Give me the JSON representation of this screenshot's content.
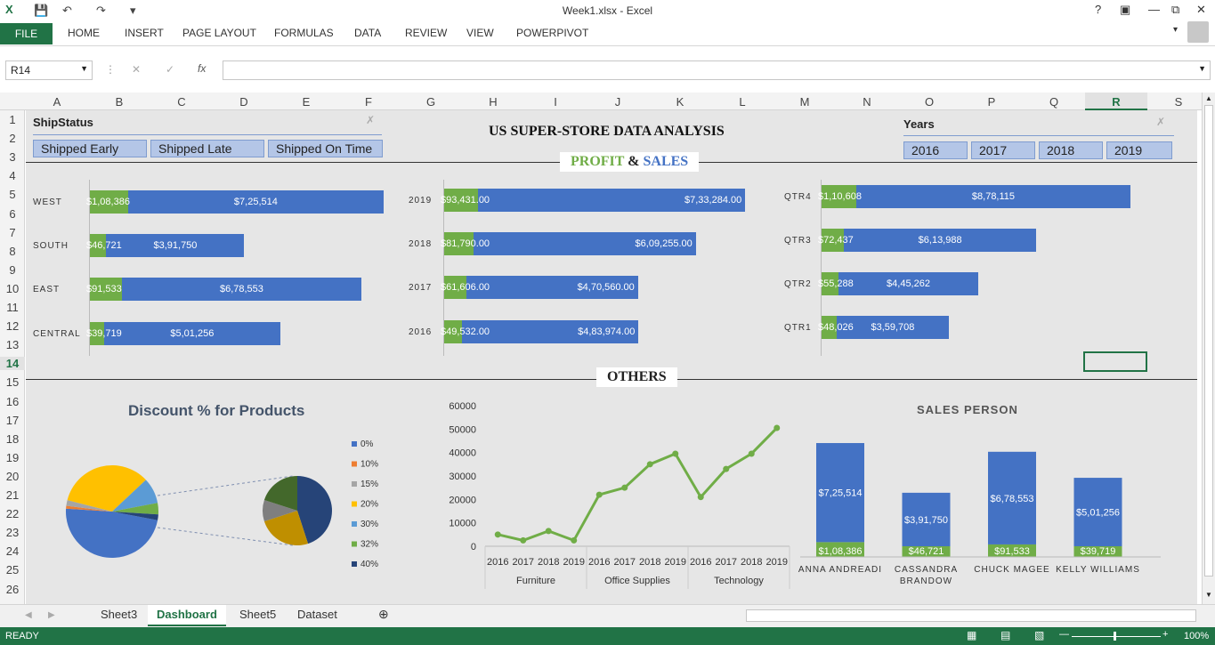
{
  "window": {
    "title": "Week1.xlsx - Excel"
  },
  "ribbon_tabs": [
    "FILE",
    "HOME",
    "INSERT",
    "PAGE LAYOUT",
    "FORMULAS",
    "DATA",
    "REVIEW",
    "VIEW",
    "POWERPIVOT"
  ],
  "formula_bar": {
    "name_box": "R14",
    "fx": "fx",
    "value": ""
  },
  "columns": [
    "A",
    "B",
    "C",
    "D",
    "E",
    "F",
    "G",
    "H",
    "I",
    "J",
    "K",
    "L",
    "M",
    "N",
    "O",
    "P",
    "Q",
    "R",
    "S"
  ],
  "rows": [
    "1",
    "2",
    "3",
    "4",
    "5",
    "6",
    "7",
    "8",
    "9",
    "10",
    "11",
    "12",
    "13",
    "14",
    "15",
    "16",
    "17",
    "18",
    "19",
    "20",
    "21",
    "22",
    "23",
    "24",
    "25",
    "26"
  ],
  "dashboard": {
    "title": "US SUPER-STORE DATA ANALYSIS",
    "profit_word": "PROFIT",
    "amp": "&",
    "sales_word": "SALES",
    "others": "OTHERS",
    "shipstatus": {
      "title": "ShipStatus",
      "items": [
        "Shipped Early",
        "Shipped Late",
        "Shipped On Time"
      ]
    },
    "years": {
      "title": "Years",
      "items": [
        "2016",
        "2017",
        "2018",
        "2019"
      ]
    }
  },
  "chart_data": [
    {
      "type": "bar",
      "orientation": "horizontal",
      "stacked": true,
      "categories": [
        "WEST",
        "SOUTH",
        "EAST",
        "CENTRAL"
      ],
      "series": [
        {
          "values": [
            108386,
            46721,
            91533,
            39719
          ],
          "labels": [
            "$1,08,386",
            "$46,721",
            "$91,533",
            "$39,719"
          ]
        },
        {
          "values": [
            725514,
            391750,
            678553,
            501256
          ],
          "labels": [
            "$7,25,514",
            "$3,91,750",
            "$6,78,553",
            "$5,01,256"
          ]
        }
      ]
    },
    {
      "type": "bar",
      "orientation": "horizontal",
      "stacked": true,
      "categories": [
        "2019",
        "2018",
        "2017",
        "2016"
      ],
      "series": [
        {
          "values": [
            93431,
            81790,
            61606,
            49532
          ],
          "labels": [
            "$93,431.00",
            "$81,790.00",
            "$61,606.00",
            "$49,532.00"
          ]
        },
        {
          "values": [
            733284,
            609255,
            470560,
            483974
          ],
          "labels": [
            "$7,33,284.00",
            "$6,09,255.00",
            "$4,70,560.00",
            "$4,83,974.00"
          ]
        }
      ]
    },
    {
      "type": "bar",
      "orientation": "horizontal",
      "stacked": true,
      "categories": [
        "QTR4",
        "QTR3",
        "QTR2",
        "QTR1"
      ],
      "series": [
        {
          "values": [
            110608,
            72437,
            55288,
            48026
          ],
          "labels": [
            "$1,10,608",
            "$72,437",
            "$55,288",
            "$48,026"
          ]
        },
        {
          "values": [
            878115,
            613988,
            445262,
            359708
          ],
          "labels": [
            "$8,78,115",
            "$6,13,988",
            "$4,45,262",
            "$3,59,708"
          ]
        }
      ]
    },
    {
      "type": "pie",
      "title": "Discount % for Products",
      "categories": [
        "0%",
        "10%",
        "15%",
        "20%",
        "30%",
        "32%",
        "40%"
      ],
      "values": [
        48,
        1,
        2,
        34,
        9,
        4,
        2
      ],
      "colors": [
        "#4472c4",
        "#ed7d31",
        "#a5a5a5",
        "#ffc000",
        "#5b9bd5",
        "#70ad47",
        "#264478"
      ]
    },
    {
      "type": "line",
      "ylim": [
        0,
        60000
      ],
      "yticks": [
        0,
        10000,
        20000,
        30000,
        40000,
        50000,
        60000
      ],
      "groups": [
        "Furniture",
        "Office Supplies",
        "Technology"
      ],
      "x": [
        "2016",
        "2017",
        "2018",
        "2019",
        "2016",
        "2017",
        "2018",
        "2019",
        "2016",
        "2017",
        "2018",
        "2019"
      ],
      "values": [
        5000,
        2500,
        6500,
        2500,
        22000,
        25000,
        35000,
        39500,
        21000,
        33000,
        39500,
        50500
      ]
    },
    {
      "type": "bar",
      "stacked": true,
      "title": "SALES PERSON",
      "categories": [
        "ANNA ANDREADI",
        "CASSANDRA BRANDOW",
        "CHUCK MAGEE",
        "KELLY WILLIAMS"
      ],
      "series": [
        {
          "values": [
            108386,
            46721,
            91533,
            39719
          ],
          "labels": [
            "$1,08,386",
            "$46,721",
            "$91,533",
            "$39,719"
          ]
        },
        {
          "values": [
            725514,
            391750,
            678553,
            501256
          ],
          "labels": [
            "$7,25,514",
            "$3,91,750",
            "$6,78,553",
            "$5,01,256"
          ]
        }
      ]
    }
  ],
  "sheet_tabs": [
    "Sheet3",
    "Dashboard",
    "Sheet5",
    "Dataset"
  ],
  "status": {
    "ready": "READY",
    "zoom": "100%"
  }
}
